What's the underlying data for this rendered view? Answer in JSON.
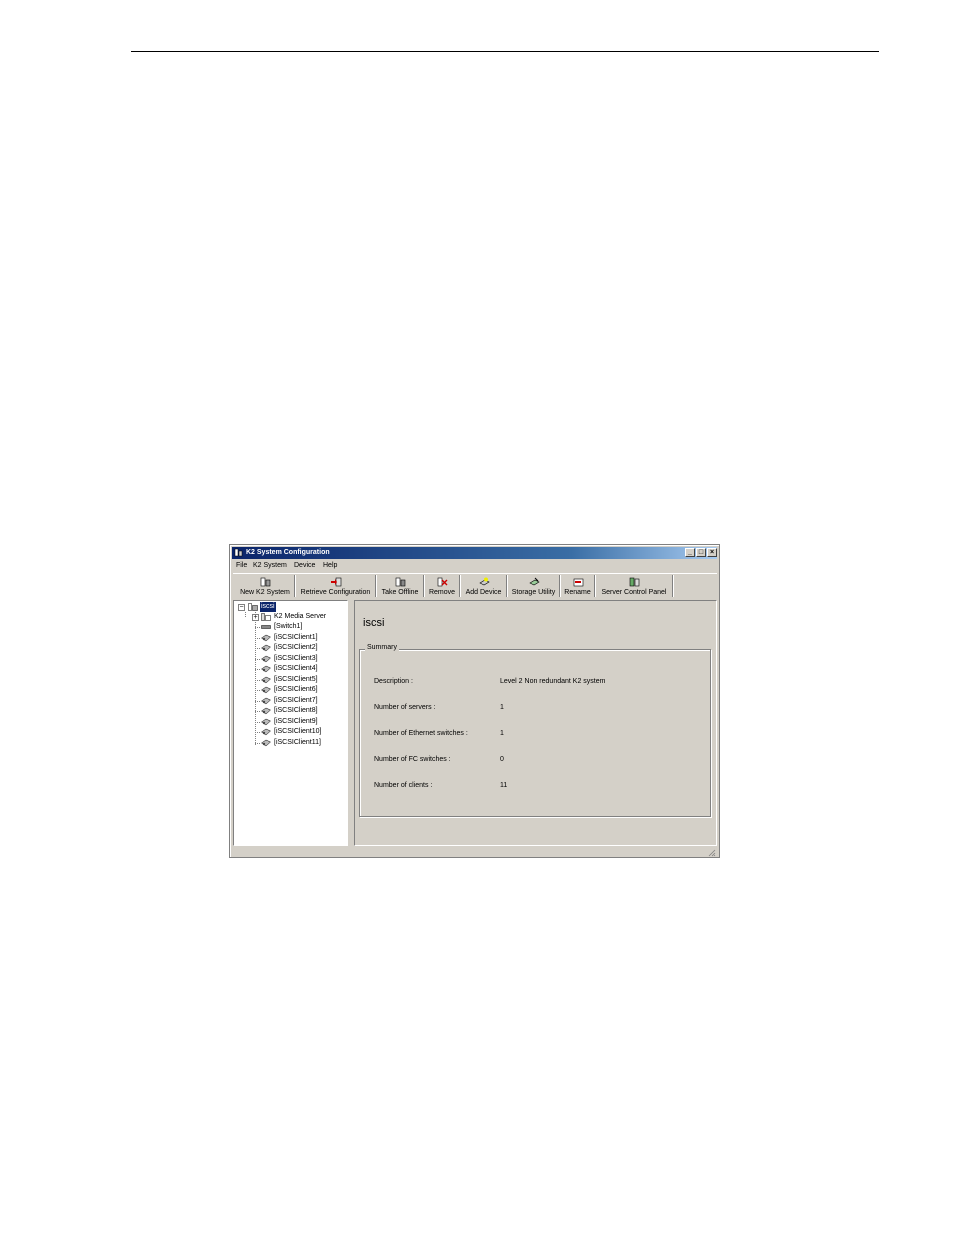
{
  "window": {
    "title": "K2 System Configuration",
    "controls": {
      "minimize": "_",
      "maximize": "□",
      "close": "×"
    }
  },
  "menu": [
    "File",
    "K2 System",
    "Device",
    "Help"
  ],
  "toolbar": [
    {
      "label": "New K2 System",
      "icon": "new-system-icon"
    },
    {
      "label": "Retrieve Configuration",
      "icon": "retrieve-config-icon"
    },
    {
      "label": "Take Offline",
      "icon": "take-offline-icon"
    },
    {
      "label": "Remove",
      "icon": "remove-icon"
    },
    {
      "label": "Add Device",
      "icon": "add-device-icon"
    },
    {
      "label": "Storage Utility",
      "icon": "storage-utility-icon"
    },
    {
      "label": "Rename",
      "icon": "rename-icon"
    },
    {
      "label": "Server Control Panel",
      "icon": "server-control-panel-icon"
    }
  ],
  "tree": {
    "root": "iscsi",
    "children": [
      "K2 Media Server",
      "[Switch1]",
      "[iSCSIClient1]",
      "[iSCSIClient2]",
      "[iSCSIClient3]",
      "[iSCSIClient4]",
      "[iSCSIClient5]",
      "[iSCSIClient6]",
      "[iSCSIClient7]",
      "[iSCSIClient8]",
      "[iSCSIClient9]",
      "[iSCSIClient10]",
      "[iSCSIClient11]"
    ]
  },
  "detail": {
    "title": "iscsi",
    "group_label": "Summary",
    "rows": [
      {
        "label": "Description :",
        "value": "Level 2 Non redundant K2 system"
      },
      {
        "label": "Number of servers :",
        "value": "1"
      },
      {
        "label": "Number of Ethernet switches :",
        "value": "1"
      },
      {
        "label": "Number of FC switches :",
        "value": "0"
      },
      {
        "label": "Number of clients :",
        "value": "11"
      }
    ]
  },
  "colors": {
    "titlebar": "#0a246a",
    "chrome": "#d4d0c8",
    "selection": "#0a246a"
  }
}
